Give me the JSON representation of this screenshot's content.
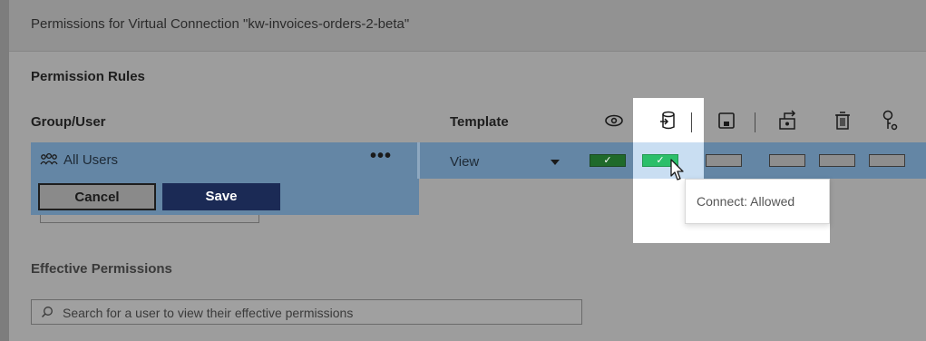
{
  "dialog": {
    "title": "Permissions for Virtual Connection \"kw-invoices-orders-2-beta\""
  },
  "permission_rules": {
    "heading": "Permission Rules",
    "columns": {
      "group_user": "Group/User",
      "template": "Template",
      "capability_icons": [
        "view-icon",
        "connect-icon",
        "save-icon",
        "change-owner-icon",
        "delete-icon",
        "set-permissions-icon"
      ]
    },
    "row": {
      "user_label": "All Users",
      "more_label": "•••",
      "template_value": "View",
      "capabilities": [
        {
          "name": "view",
          "state": "allowed",
          "mark": "✓"
        },
        {
          "name": "connect",
          "state": "allowed",
          "mark": "✓"
        },
        {
          "name": "save",
          "state": "unspecified",
          "mark": ""
        },
        {
          "name": "change-owner",
          "state": "unspecified",
          "mark": ""
        },
        {
          "name": "delete",
          "state": "unspecified",
          "mark": ""
        },
        {
          "name": "set-permissions",
          "state": "unspecified",
          "mark": ""
        }
      ]
    },
    "buttons": {
      "cancel": "Cancel",
      "save": "Save"
    }
  },
  "tooltip": {
    "text": "Connect: Allowed"
  },
  "effective_permissions": {
    "heading": "Effective Permissions",
    "search_placeholder": "Search for a user to view their effective permissions"
  },
  "colors": {
    "allowed": "#1f6a2a",
    "allowed_highlight": "#2bbf6a",
    "row": "#6486a5",
    "save_button": "#1b2a55"
  }
}
